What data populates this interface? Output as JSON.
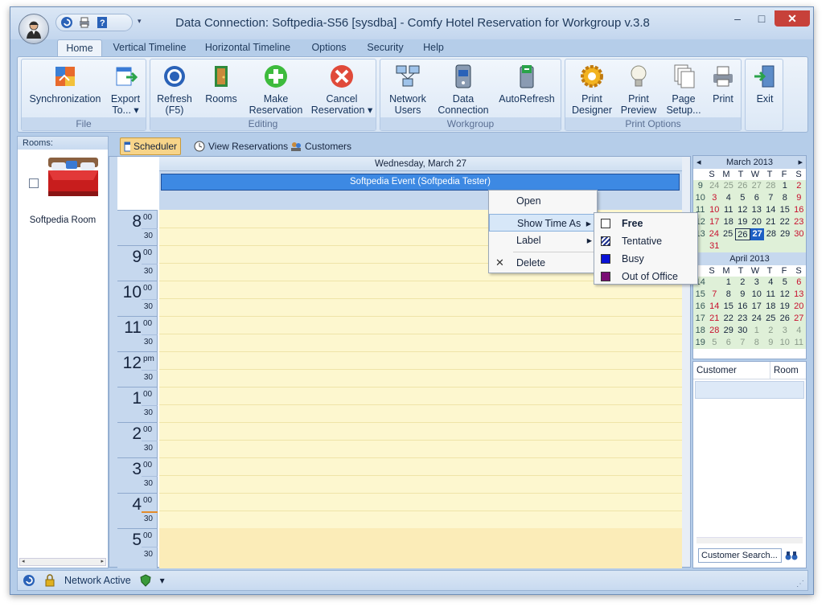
{
  "window": {
    "title": "Data Connection: Softpedia-S56 [sysdba] - Comfy Hotel Reservation for Workgroup v.3.8",
    "controls": {
      "minimize": "–",
      "maximize": "□",
      "close": "✕"
    }
  },
  "qat": {
    "dropdown_glyph": "▾"
  },
  "ribbon_tabs": [
    {
      "label": "Home"
    },
    {
      "label": "Vertical Timeline"
    },
    {
      "label": "Horizontal Timeline"
    },
    {
      "label": "Options"
    },
    {
      "label": "Security"
    },
    {
      "label": "Help"
    }
  ],
  "groups": {
    "file": {
      "label": "File",
      "buttons": [
        {
          "line1": "Synchronization",
          "line2": "",
          "icon": "sync-icon"
        },
        {
          "line1": "Export",
          "line2": "To... ▾",
          "icon": "export-icon"
        }
      ]
    },
    "editing": {
      "label": "Editing",
      "buttons": [
        {
          "line1": "Refresh",
          "line2": "(F5)",
          "icon": "refresh-icon"
        },
        {
          "line1": "Rooms",
          "line2": "",
          "icon": "rooms-icon"
        },
        {
          "line1": "Make",
          "line2": "Reservation",
          "icon": "add-icon"
        },
        {
          "line1": "Cancel",
          "line2": "Reservation ▾",
          "icon": "cancel-icon"
        }
      ]
    },
    "workgroup": {
      "label": "Workgroup",
      "buttons": [
        {
          "line1": "Network",
          "line2": "Users",
          "icon": "network-users-icon"
        },
        {
          "line1": "Data",
          "line2": "Connection",
          "icon": "database-icon"
        },
        {
          "line1": "AutoRefresh",
          "line2": "",
          "icon": "autorefresh-icon"
        }
      ]
    },
    "print": {
      "label": "Print Options",
      "buttons": [
        {
          "line1": "Print",
          "line2": "Designer",
          "icon": "gear-icon"
        },
        {
          "line1": "Print",
          "line2": "Preview",
          "icon": "bulb-icon"
        },
        {
          "line1": "Page",
          "line2": "Setup...",
          "icon": "pages-icon"
        },
        {
          "line1": "Print",
          "line2": "",
          "icon": "printer-icon"
        }
      ]
    },
    "exit": {
      "label": "Exit"
    }
  },
  "rooms_panel": {
    "header": "Rooms:",
    "room_name": "Softpedia Room",
    "scroll_left": "◂",
    "scroll_right": "▸"
  },
  "content_tabs": [
    {
      "label": "Scheduler"
    },
    {
      "label": "View Reservations"
    },
    {
      "label": "Customers"
    }
  ],
  "scheduler": {
    "date_header": "Wednesday, March 27",
    "event": "Softpedia Event (Softpedia Tester)",
    "hours": [
      {
        "h": "8",
        "s": "00",
        "half": "30"
      },
      {
        "h": "9",
        "s": "00",
        "half": "30"
      },
      {
        "h": "10",
        "s": "00",
        "half": "30"
      },
      {
        "h": "11",
        "s": "00",
        "half": "30"
      },
      {
        "h": "12",
        "s": "pm",
        "half": "30"
      },
      {
        "h": "1",
        "s": "00",
        "half": "30"
      },
      {
        "h": "2",
        "s": "00",
        "half": "30"
      },
      {
        "h": "3",
        "s": "00",
        "half": "30"
      },
      {
        "h": "4",
        "s": "00",
        "half": "30"
      },
      {
        "h": "5",
        "s": "00",
        "half": "30"
      }
    ]
  },
  "context_menu": {
    "open": "Open",
    "show_time_as": "Show Time As",
    "label": "Label",
    "delete": "Delete",
    "delete_icon": "✕",
    "arrow": "▸"
  },
  "submenu": {
    "items": [
      {
        "label": "Free",
        "swatch": "#ffffff"
      },
      {
        "label": "Tentative",
        "swatch": "#1b2f8f"
      },
      {
        "label": "Busy",
        "swatch": "#0a12d6"
      },
      {
        "label": "Out of Office",
        "swatch": "#7a0d74"
      }
    ]
  },
  "calendar": {
    "weekday_letters": [
      "S",
      "M",
      "T",
      "W",
      "T",
      "F",
      "S"
    ],
    "nav_prev": "◂",
    "nav_next": "▸",
    "months": [
      {
        "title": "March 2013",
        "weeks": [
          {
            "n": "9",
            "days": [
              "24",
              "25",
              "26",
              "27",
              "28",
              "1",
              "2"
            ]
          },
          {
            "n": "10",
            "days": [
              "3",
              "4",
              "5",
              "6",
              "7",
              "8",
              "9"
            ]
          },
          {
            "n": "11",
            "days": [
              "10",
              "11",
              "12",
              "13",
              "14",
              "15",
              "16"
            ]
          },
          {
            "n": "12",
            "days": [
              "17",
              "18",
              "19",
              "20",
              "21",
              "22",
              "23"
            ]
          },
          {
            "n": "13",
            "days": [
              "24",
              "25",
              "26",
              "27",
              "28",
              "29",
              "30"
            ]
          },
          {
            "n": "",
            "days": [
              "31",
              "",
              "",
              "",
              "",
              "",
              ""
            ]
          }
        ]
      },
      {
        "title": "April 2013",
        "weeks": [
          {
            "n": "14",
            "days": [
              "",
              "1",
              "2",
              "3",
              "4",
              "5",
              "6"
            ]
          },
          {
            "n": "15",
            "days": [
              "7",
              "8",
              "9",
              "10",
              "11",
              "12",
              "13"
            ]
          },
          {
            "n": "16",
            "days": [
              "14",
              "15",
              "16",
              "17",
              "18",
              "19",
              "20"
            ]
          },
          {
            "n": "17",
            "days": [
              "21",
              "22",
              "23",
              "24",
              "25",
              "26",
              "27"
            ]
          },
          {
            "n": "18",
            "days": [
              "28",
              "29",
              "30",
              "1",
              "2",
              "3",
              "4"
            ]
          },
          {
            "n": "19",
            "days": [
              "5",
              "6",
              "7",
              "8",
              "9",
              "10",
              "11"
            ]
          }
        ]
      }
    ],
    "today": "27",
    "selected": "26"
  },
  "customers": {
    "col_customer": "Customer",
    "col_room": "Room",
    "search_label": "Customer Search..."
  },
  "status": {
    "text": "Network Active",
    "dropdown": "▾",
    "grip": "⋰"
  }
}
